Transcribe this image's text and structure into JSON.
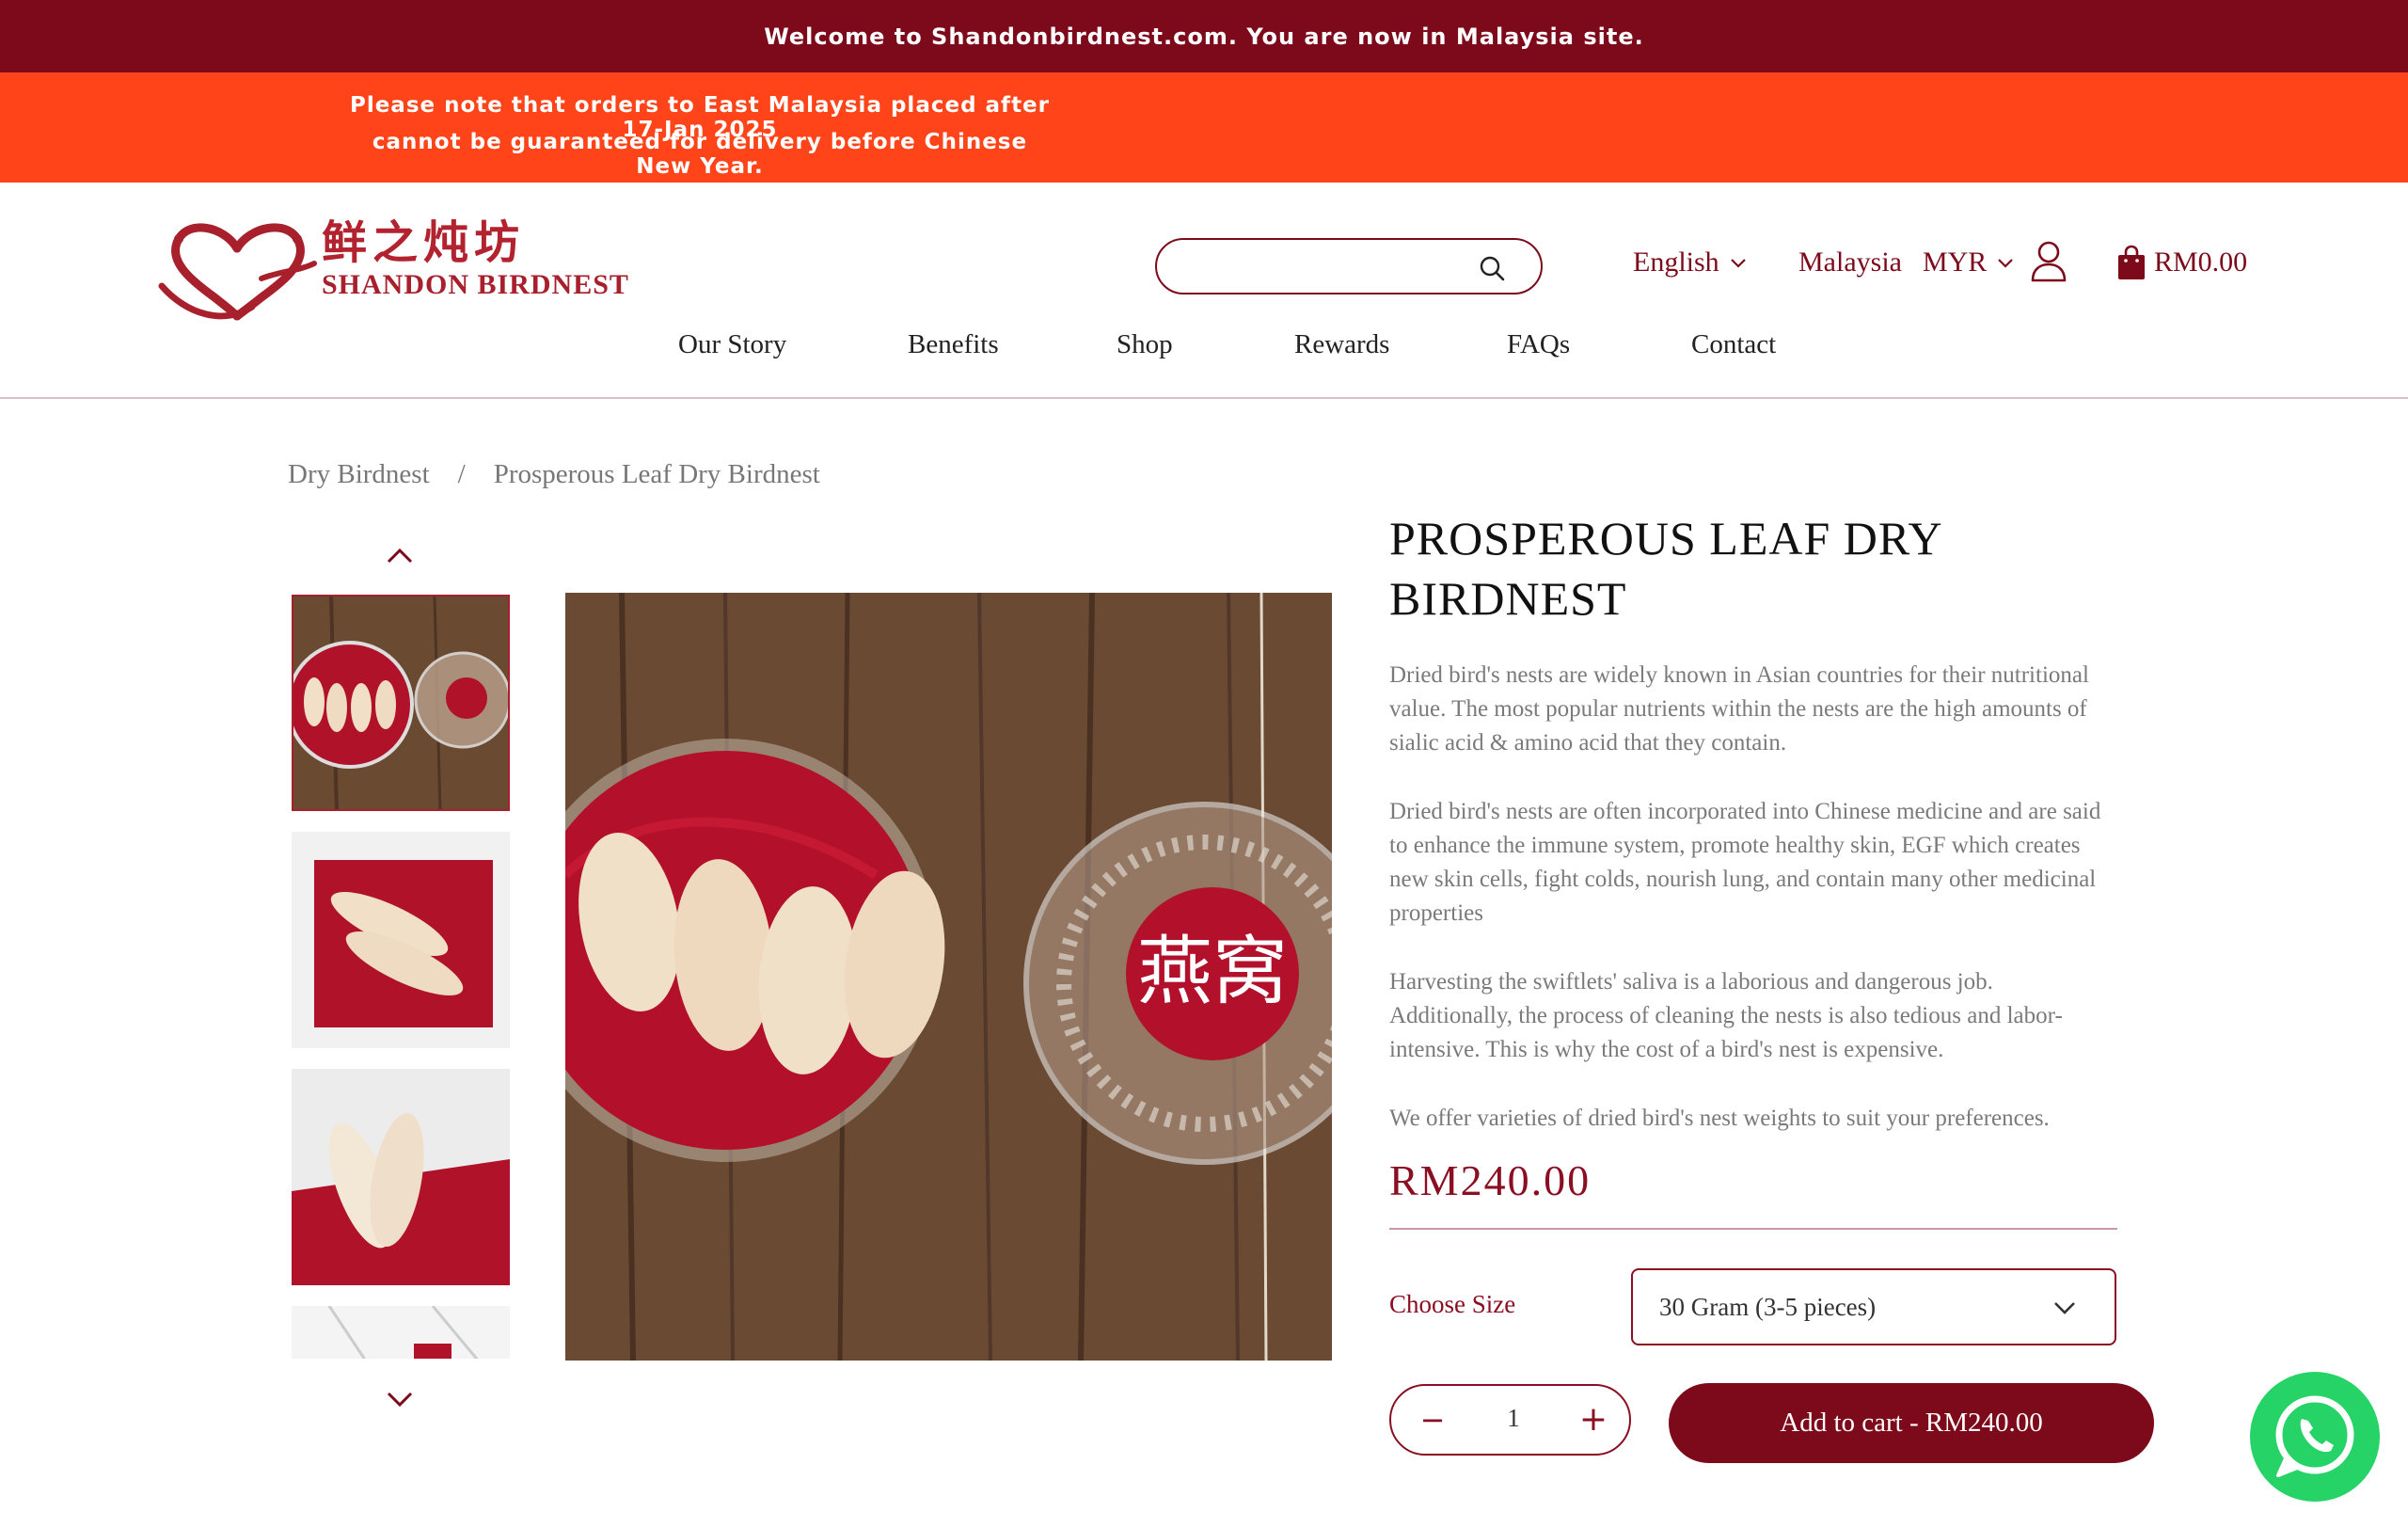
{
  "announcement": {
    "welcome": "Welcome to Shandonbirdnest.com. You are now in Malaysia site.",
    "notice_line1": "Please note that orders to East Malaysia placed after 17-Jan 2025",
    "notice_line2": "cannot be guaranteed for delivery before Chinese New Year."
  },
  "header": {
    "logo_cn": "鲜之炖坊",
    "logo_en": "SHANDON BIRDNEST",
    "search_placeholder": "",
    "language": "English",
    "region": "Malaysia",
    "currency": "MYR",
    "cart_total": "RM0.00"
  },
  "nav": {
    "items": [
      "Our Story",
      "Benefits",
      "Shop",
      "Rewards",
      "FAQs",
      "Contact"
    ]
  },
  "breadcrumb": {
    "items": [
      "Dry Birdnest",
      "/",
      "Prosperous Leaf Dry Birdnest"
    ]
  },
  "product": {
    "title_line1": "PROSPEROUS LEAF DRY",
    "title_line2": "BIRDNEST",
    "description": [
      "Dried bird's nests are widely known in Asian countries for their nutritional value. The most popular nutrients within the nests are the high amounts of sialic acid & amino acid that they contain.",
      "Dried bird's nests are often incorporated into Chinese medicine and are said to enhance the immune system, promote healthy skin, EGF which creates new skin cells, fight colds, nourish lung, and contain many other medicinal properties",
      "Harvesting the swiftlets' saliva is a laborious and dangerous job. Additionally, the process of cleaning the nests is also tedious and labor-intensive. This is why the cost of a bird's nest is expensive.",
      "We offer varieties of dried bird's nest weights to suit your preferences."
    ],
    "price": "RM240.00",
    "size_label": "Choose Size",
    "size_selected": "30 Gram (3-5 pieces)",
    "quantity": "1",
    "add_to_cart": "Add to cart - RM240.00"
  },
  "colors": {
    "brand_dark": "#7d0a1a",
    "notice_orange": "#ff4419",
    "whatsapp_green": "#25d366"
  }
}
